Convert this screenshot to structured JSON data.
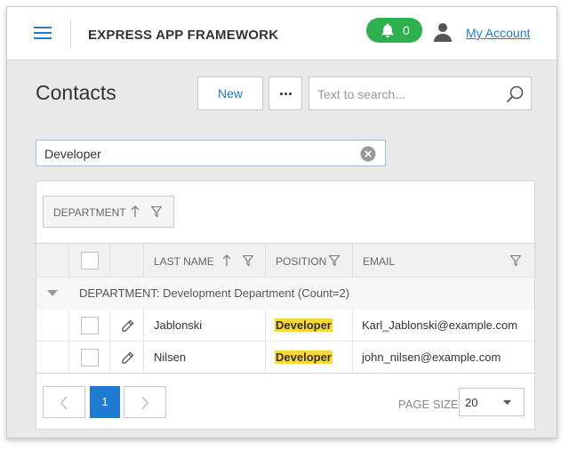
{
  "header": {
    "app_title": "EXPRESS APP FRAMEWORK",
    "notifications_count": "0",
    "account_label": "My Account"
  },
  "page": {
    "title": "Contacts"
  },
  "toolbar": {
    "new_label": "New",
    "search_placeholder": "Text to search..."
  },
  "filter": {
    "value": "Developer"
  },
  "grid": {
    "group_panel_chip": "DEPARTMENT",
    "columns": {
      "last_name": "LAST NAME",
      "position": "POSITION",
      "email": "EMAIL"
    },
    "group_row_label": "DEPARTMENT: Development Department (Count=2)",
    "rows": [
      {
        "last_name": "Jablonski",
        "position": "Developer",
        "email": "Karl_Jablonski@example.com"
      },
      {
        "last_name": "Nilsen",
        "position": "Developer",
        "email": "john_nilsen@example.com"
      }
    ]
  },
  "pager": {
    "current_page": "1",
    "page_size_label": "PAGE SIZE",
    "page_size_value": "20"
  },
  "colors": {
    "accent": "#1f7bd1",
    "notification_badge": "#2eb04f",
    "highlight": "#fcd738"
  },
  "icons": [
    "hamburger-icon",
    "bell-icon",
    "user-icon",
    "search-icon",
    "clear-icon",
    "sort-up-icon",
    "filter-icon",
    "collapse-caret-icon",
    "edit-pencil-icon",
    "chevron-left-icon",
    "chevron-right-icon",
    "chevron-down-icon"
  ]
}
